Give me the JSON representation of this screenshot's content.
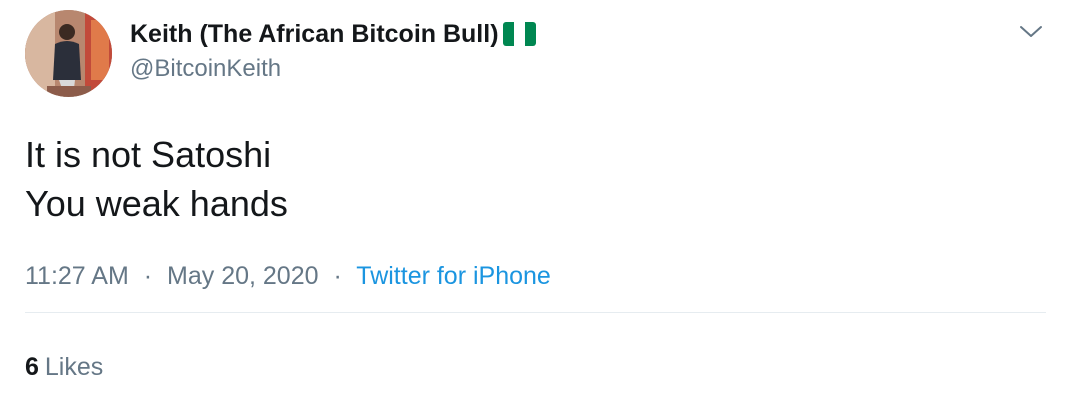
{
  "author": {
    "display_name": "Keith (The African Bitcoin Bull)",
    "flag_icon": "nigeria-flag-icon",
    "handle": "@BitcoinKeith"
  },
  "tweet": {
    "lines": [
      "It is not Satoshi",
      "You weak hands"
    ]
  },
  "meta": {
    "time": "11:27 AM",
    "date": "May 20, 2020",
    "separator": "·",
    "source": "Twitter for iPhone"
  },
  "stats": {
    "likes_count": "6",
    "likes_label": "Likes"
  },
  "colors": {
    "text": "#14171a",
    "secondary": "#657786",
    "link": "#1b95e0",
    "divider": "#e6ecf0",
    "flag_green": "#008751",
    "flag_white": "#ffffff"
  }
}
